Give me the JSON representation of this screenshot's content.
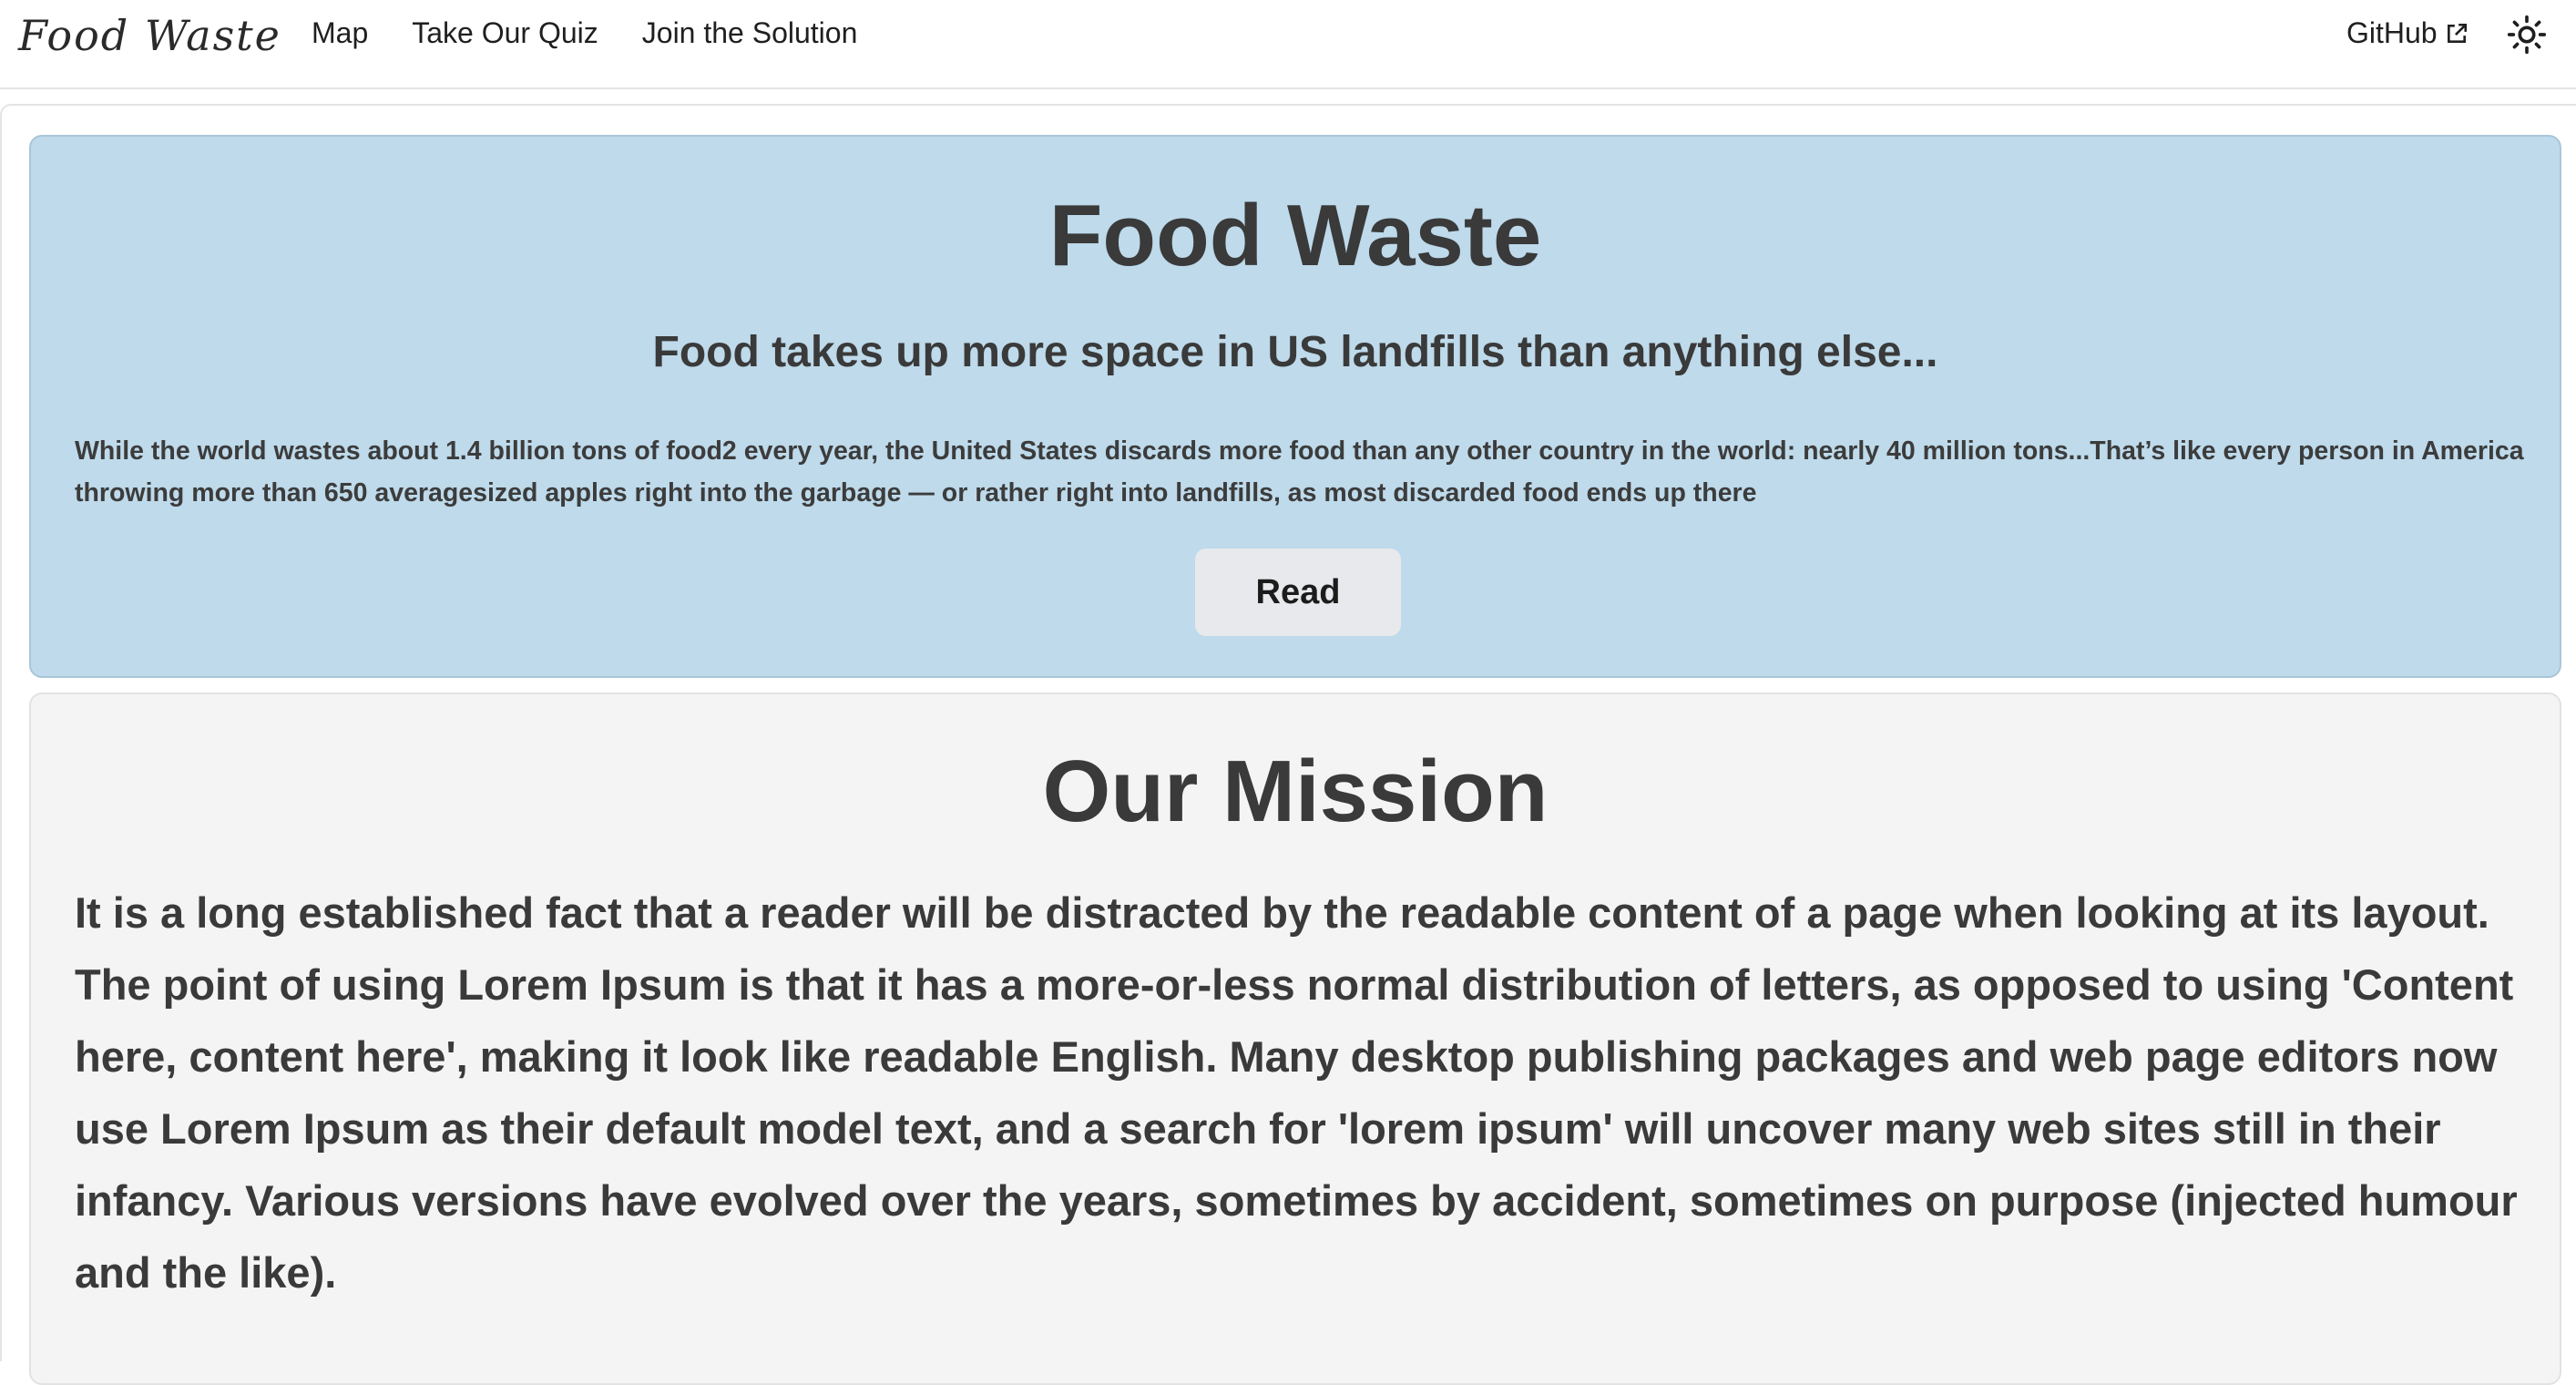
{
  "nav": {
    "brand": "Food Waste",
    "links": [
      "Map",
      "Take Our Quiz",
      "Join the Solution"
    ],
    "github_label": "GitHub",
    "github_icon": "external-link-icon",
    "theme_icon": "sun-icon"
  },
  "hero": {
    "title": "Food Waste",
    "subtitle": "Food takes up more space in US landfills than anything else...",
    "text": "While the world wastes about 1.4 billion tons of food2 every year, the United States discards more food than any other country in the world: nearly 40 million tons...That’s like every person in America throwing more than 650 averagesized apples right into the garbage — or rather right into landfills, as most discarded food ends up there",
    "button_label": "Read",
    "background_color": "#bedaeb"
  },
  "mission": {
    "title": "Our Mission",
    "text": "It is a long established fact that a reader will be distracted by the readable content of a page when looking at its layout. The point of using Lorem Ipsum is that it has a more-or-less normal distribution of letters, as opposed to using 'Content here, content here', making it look like readable English. Many desktop publishing packages and web page editors now use Lorem Ipsum as their default model text, and a search for 'lorem ipsum' will uncover many web sites still in their infancy. Various versions have evolved over the years, sometimes by accident, sometimes on purpose (injected humour and the like).",
    "background_color": "#f4f4f4"
  }
}
